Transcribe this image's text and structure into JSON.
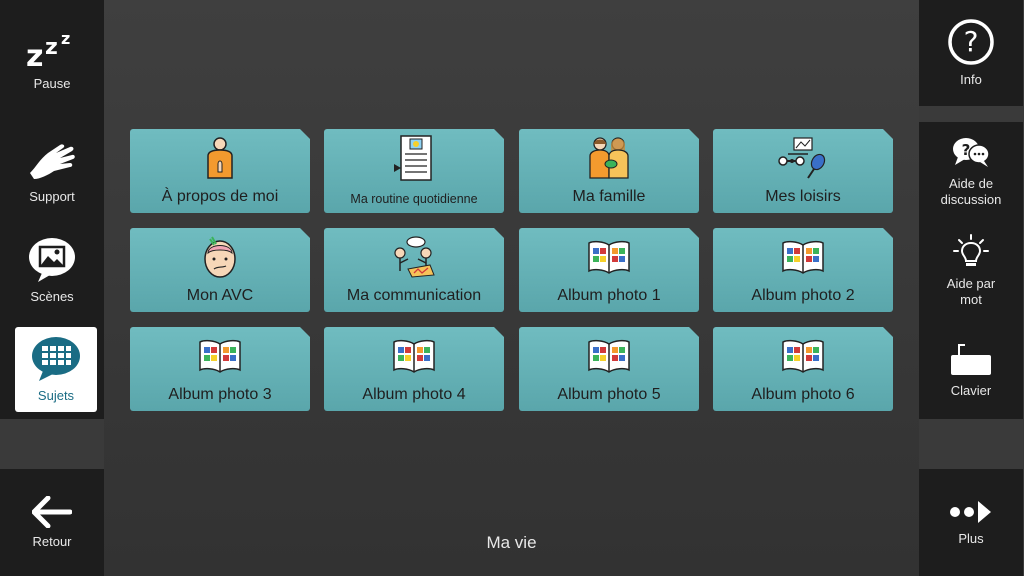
{
  "left_sidebar": {
    "pause": "Pause",
    "support": "Support",
    "scenes": "Scènes",
    "sujets": "Sujets"
  },
  "right_sidebar": {
    "info": "Info",
    "aide_discussion": "Aide de discussion",
    "aide_mot": "Aide par mot",
    "clavier": "Clavier"
  },
  "bottom": {
    "retour": "Retour",
    "plus": "Plus",
    "page_title": "Ma vie"
  },
  "tiles": [
    {
      "label": "À propos de moi",
      "icon": "person-icon"
    },
    {
      "label": "Ma routine quotidienne",
      "icon": "schedule-icon"
    },
    {
      "label": "Ma famille",
      "icon": "family-icon"
    },
    {
      "label": "Mes loisirs",
      "icon": "hobbies-icon"
    },
    {
      "label": "Mon AVC",
      "icon": "brain-head-icon"
    },
    {
      "label": "Ma communication",
      "icon": "communication-icon"
    },
    {
      "label": "Album photo 1",
      "icon": "photo-album-icon"
    },
    {
      "label": "Album photo 2",
      "icon": "photo-album-icon"
    },
    {
      "label": "Album photo 3",
      "icon": "photo-album-icon"
    },
    {
      "label": "Album photo 4",
      "icon": "photo-album-icon"
    },
    {
      "label": "Album photo 5",
      "icon": "photo-album-icon"
    },
    {
      "label": "Album photo 6",
      "icon": "photo-album-icon"
    }
  ],
  "colors": {
    "tile": "#65b1b6",
    "sidebar": "#1d1d1d",
    "accent": "#1a6c84"
  }
}
